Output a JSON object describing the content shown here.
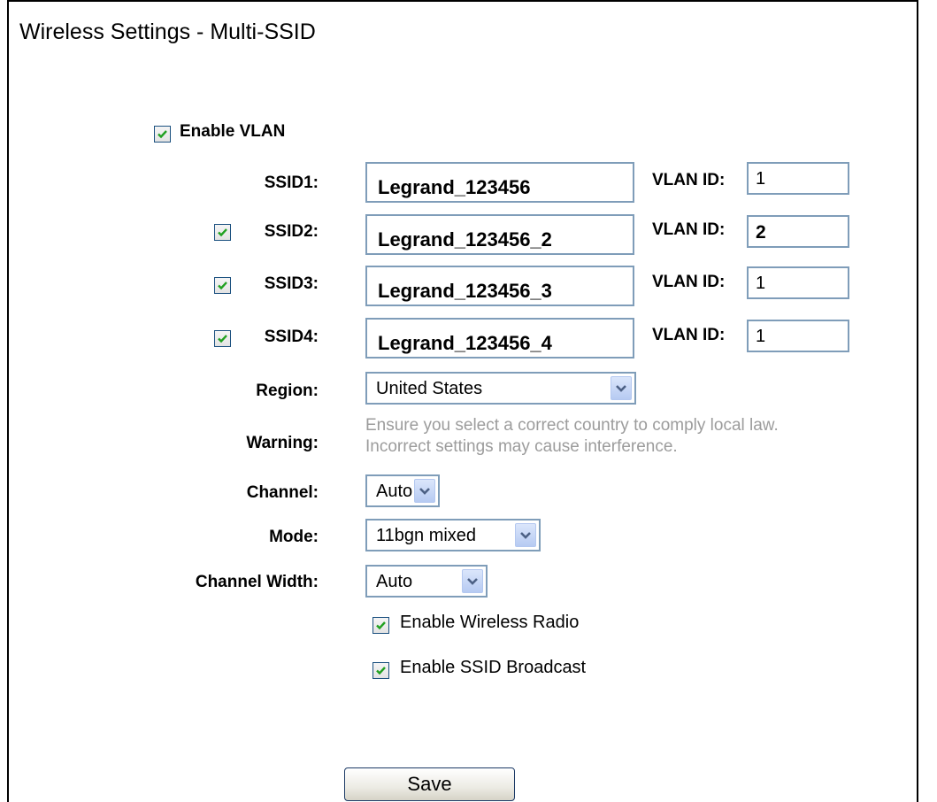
{
  "page": {
    "title": "Wireless Settings - Multi-SSID"
  },
  "vlan": {
    "enable_label": "Enable VLAN",
    "enabled": true
  },
  "ssids": [
    {
      "label": "SSID1:",
      "value": "Legrand_123456",
      "vlan_label": "VLAN ID:",
      "vlan_id": "1",
      "has_checkbox": false
    },
    {
      "label": "SSID2:",
      "value": "Legrand_123456_2",
      "vlan_label": "VLAN ID:",
      "vlan_id": "2",
      "has_checkbox": true
    },
    {
      "label": "SSID3:",
      "value": "Legrand_123456_3",
      "vlan_label": "VLAN ID:",
      "vlan_id": "1",
      "has_checkbox": true
    },
    {
      "label": "SSID4:",
      "value": "Legrand_123456_4",
      "vlan_label": "VLAN ID:",
      "vlan_id": "1",
      "has_checkbox": true
    }
  ],
  "region": {
    "label": "Region:",
    "value": "United States"
  },
  "warning": {
    "label": "Warning:",
    "line1": "Ensure you select a correct country to comply local law.",
    "line2": "Incorrect settings may cause interference."
  },
  "channel": {
    "label": "Channel:",
    "value": "Auto"
  },
  "mode": {
    "label": "Mode:",
    "value": "11bgn mixed"
  },
  "channel_width": {
    "label": "Channel Width:",
    "value": "Auto"
  },
  "options": {
    "wireless_radio": "Enable Wireless Radio",
    "ssid_broadcast": "Enable SSID Broadcast"
  },
  "save_label": "Save",
  "colors": {
    "check": "#21a121",
    "input_border": "#7f9db9",
    "warning_text": "#9c9c9c"
  }
}
